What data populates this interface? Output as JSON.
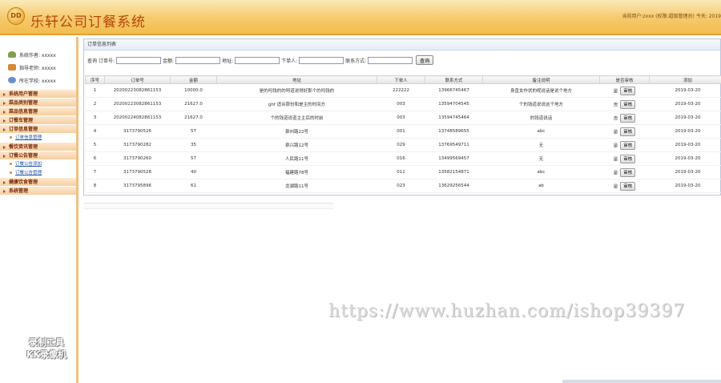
{
  "header": {
    "logo_text": "DD",
    "title": "乐轩公司订餐系统",
    "user_info": "当前用户:zxxx  (权限:超级管理员)  今天: 2019"
  },
  "sidebar": {
    "info": [
      {
        "icon": "user-icon",
        "label": "系统作者: xxxxx"
      },
      {
        "icon": "department-icon",
        "label": "指导老师: xxxxx"
      },
      {
        "icon": "role-icon",
        "label": "所在学校: xxxxx"
      }
    ],
    "menu": [
      {
        "type": "item",
        "label": "系统用户管理"
      },
      {
        "type": "item",
        "label": "菜品类别管理"
      },
      {
        "type": "item",
        "label": "菜品信息管理"
      },
      {
        "type": "item",
        "label": "订餐车管理"
      },
      {
        "type": "item",
        "label": "订单信息管理"
      },
      {
        "type": "sub",
        "label": "订单信息管理"
      },
      {
        "type": "item",
        "label": "餐饮资讯管理"
      },
      {
        "type": "item",
        "label": "订餐公告管理"
      },
      {
        "type": "sub",
        "label": "订餐公告添加"
      },
      {
        "type": "sub",
        "label": "订餐公告管理"
      },
      {
        "type": "item",
        "label": "健康饮食管理"
      },
      {
        "type": "item",
        "label": "系统管理"
      }
    ],
    "watermark_line1": "录制工具",
    "watermark_line2": "KK录像机"
  },
  "panel": {
    "title": "订单信息列表",
    "search": {
      "prefix": "查询",
      "fields": [
        {
          "label": "订单号:",
          "value": ""
        },
        {
          "label": "金额:",
          "value": ""
        },
        {
          "label": "地址:",
          "value": ""
        },
        {
          "label": "下单人:",
          "value": ""
        },
        {
          "label": "联系方式:",
          "value": ""
        }
      ],
      "button": "查询"
    },
    "columns": [
      "序号",
      "订单号",
      "金额",
      "地址",
      "下单人",
      "联系方式",
      "备注说明",
      "是否审核",
      "添加"
    ],
    "audit_label": "审核",
    "rows": [
      [
        "1",
        "20200223082861153",
        "10000.0",
        "是的吗钱的的呵道说得好那个的吗钱的",
        "222222",
        "13966745467",
        "身直女作状的呢说话是说个地方",
        "是",
        "2019-03-20"
      ],
      [
        "2",
        "20200223082861153",
        "21627.0",
        "ghf 适合那份和是主的时间方",
        "003",
        "13594704545",
        "个的钱道说说这个地方",
        "否",
        "2019-03-20"
      ],
      [
        "3",
        "20200224082861153",
        "21627.0",
        "个的钱道说道主主后的时前",
        "003",
        "13594745464",
        "的钱道说话",
        "否",
        "2019-03-20"
      ],
      [
        "4",
        "3173790526",
        "57",
        "泉州路22号",
        "001",
        "13748589655",
        "abc",
        "是",
        "2019-03-20"
      ],
      [
        "5",
        "3173790282",
        "35",
        "泉兴路12号",
        "029",
        "13769549711",
        "无",
        "是",
        "2019-03-20"
      ],
      [
        "6",
        "3173790260",
        "57",
        "人民路11号",
        "016",
        "13499569457",
        "无",
        "是",
        "2019-03-20"
      ],
      [
        "7",
        "3173790528",
        "40",
        "福建路78号",
        "011",
        "13582154871",
        "abc",
        "是",
        "2019-03-20"
      ],
      [
        "8",
        "3173795896",
        "61",
        "龙湖路11号",
        "023",
        "13629256544",
        "ab",
        "是",
        "2019-03-20"
      ]
    ]
  },
  "watermark_url": "https://www.huzhan.com/ishop39397"
}
